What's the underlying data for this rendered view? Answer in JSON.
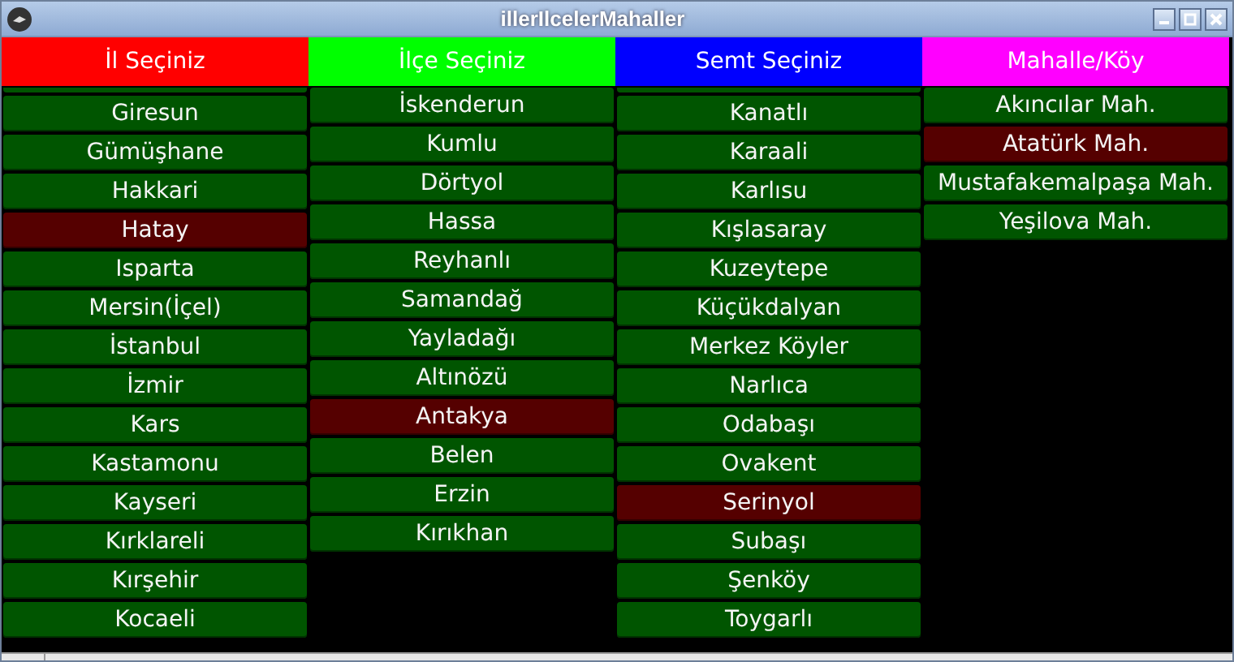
{
  "window": {
    "title": "illerIlcelerMahaller"
  },
  "columns": [
    {
      "header": "İl Seçiniz",
      "color": "#ff0000",
      "clipped_above": true,
      "items": [
        {
          "label": "Giresun",
          "selected": false
        },
        {
          "label": "Gümüşhane",
          "selected": false
        },
        {
          "label": "Hakkari",
          "selected": false
        },
        {
          "label": "Hatay",
          "selected": true
        },
        {
          "label": "Isparta",
          "selected": false
        },
        {
          "label": "Mersin(İçel)",
          "selected": false
        },
        {
          "label": "İstanbul",
          "selected": false
        },
        {
          "label": "İzmir",
          "selected": false
        },
        {
          "label": "Kars",
          "selected": false
        },
        {
          "label": "Kastamonu",
          "selected": false
        },
        {
          "label": "Kayseri",
          "selected": false
        },
        {
          "label": "Kırklareli",
          "selected": false
        },
        {
          "label": "Kırşehir",
          "selected": false
        },
        {
          "label": "Kocaeli",
          "selected": false
        }
      ]
    },
    {
      "header": "İlçe Seçiniz",
      "color": "#00ff00",
      "items": [
        {
          "label": "İskenderun",
          "selected": false
        },
        {
          "label": "Kumlu",
          "selected": false
        },
        {
          "label": "Dörtyol",
          "selected": false
        },
        {
          "label": "Hassa",
          "selected": false
        },
        {
          "label": "Reyhanlı",
          "selected": false
        },
        {
          "label": "Samandağ",
          "selected": false
        },
        {
          "label": "Yayladağı",
          "selected": false
        },
        {
          "label": "Altınözü",
          "selected": false
        },
        {
          "label": "Antakya",
          "selected": true
        },
        {
          "label": "Belen",
          "selected": false
        },
        {
          "label": "Erzin",
          "selected": false
        },
        {
          "label": "Kırıkhan",
          "selected": false
        }
      ]
    },
    {
      "header": "Semt Seçiniz",
      "color": "#0000ff",
      "clipped_above": true,
      "items": [
        {
          "label": "Kanatlı",
          "selected": false
        },
        {
          "label": "Karaali",
          "selected": false
        },
        {
          "label": "Karlısu",
          "selected": false
        },
        {
          "label": "Kışlasaray",
          "selected": false
        },
        {
          "label": "Kuzeytepe",
          "selected": false
        },
        {
          "label": "Küçükdalyan",
          "selected": false
        },
        {
          "label": "Merkez Köyler",
          "selected": false
        },
        {
          "label": "Narlıca",
          "selected": false
        },
        {
          "label": "Odabaşı",
          "selected": false
        },
        {
          "label": "Ovakent",
          "selected": false
        },
        {
          "label": "Serinyol",
          "selected": true
        },
        {
          "label": "Subaşı",
          "selected": false
        },
        {
          "label": "Şenköy",
          "selected": false
        },
        {
          "label": "Toygarlı",
          "selected": false
        }
      ]
    },
    {
      "header": "Mahalle/Köy",
      "color": "#ff00ff",
      "items": [
        {
          "label": "Akıncılar Mah.",
          "selected": false
        },
        {
          "label": "Atatürk Mah.",
          "selected": true
        },
        {
          "label": "Mustafakemalpaşa Mah.",
          "selected": false
        },
        {
          "label": "Yeşilova Mah.",
          "selected": false
        }
      ]
    }
  ]
}
